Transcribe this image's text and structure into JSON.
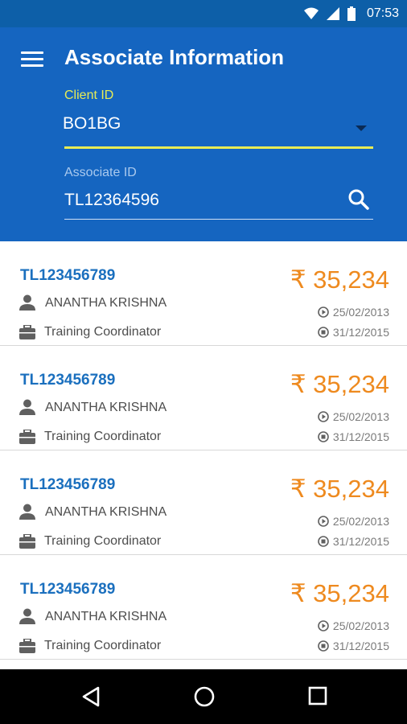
{
  "status_bar": {
    "time": "07:53",
    "icons": [
      "wifi-icon",
      "signal-icon",
      "battery-icon"
    ]
  },
  "header": {
    "menu_icon": "menu-icon",
    "title": "Associate Information",
    "client_field": {
      "label": "Client ID",
      "value": "BO1BG",
      "dropdown_icon": "dropdown-arrow-icon"
    },
    "associate_field": {
      "label": "Associate ID",
      "value": "TL12364596",
      "search_icon": "search-icon"
    }
  },
  "colors": {
    "header_bg": "#1565c0",
    "status_bg": "#0d5fa8",
    "accent_yellow": "#e7ec55",
    "id_blue": "#1a6fbe",
    "amount_orange": "#ee8a1f"
  },
  "associates": [
    {
      "id": "TL123456789",
      "name": "ANANTHA KRISHNA",
      "role": "Training Coordinator",
      "amount": "₹ 35,234",
      "start_date": "25/02/2013",
      "end_date": "31/12/2015"
    },
    {
      "id": "TL123456789",
      "name": "ANANTHA KRISHNA",
      "role": "Training Coordinator",
      "amount": "₹ 35,234",
      "start_date": "25/02/2013",
      "end_date": "31/12/2015"
    },
    {
      "id": "TL123456789",
      "name": "ANANTHA KRISHNA",
      "role": "Training Coordinator",
      "amount": "₹ 35,234",
      "start_date": "25/02/2013",
      "end_date": "31/12/2015"
    },
    {
      "id": "TL123456789",
      "name": "ANANTHA KRISHNA",
      "role": "Training Coordinator",
      "amount": "₹ 35,234",
      "start_date": "25/02/2013",
      "end_date": "31/12/2015"
    }
  ],
  "nav_bar": {
    "icons": [
      "back-icon",
      "home-icon",
      "recent-apps-icon"
    ]
  }
}
